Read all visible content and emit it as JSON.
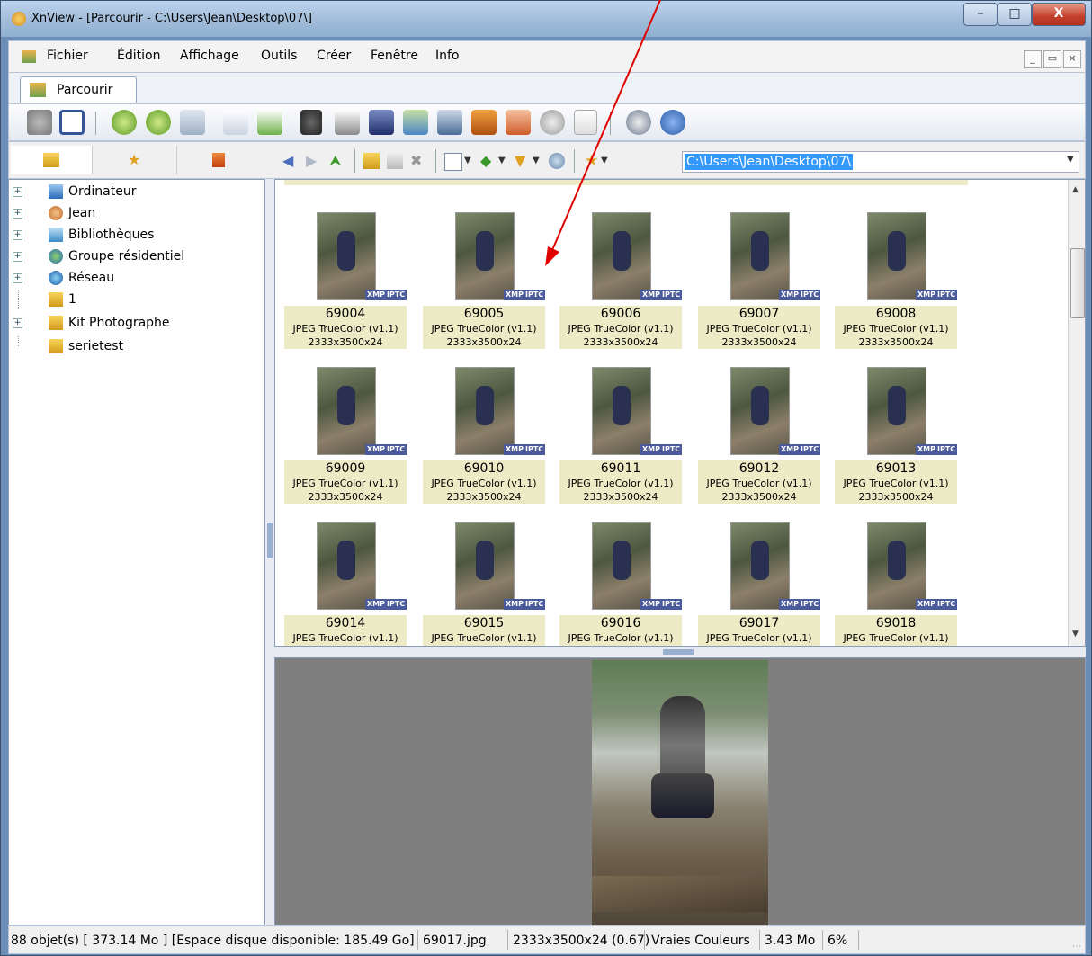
{
  "window": {
    "title": "XnView - [Parcourir - C:\\Users\\Jean\\Desktop\\07\\]",
    "min_label": "–",
    "max_label": "□",
    "close_label": "X"
  },
  "menubar": {
    "items": [
      "Fichier",
      "Édition",
      "Affichage",
      "Outils",
      "Créer",
      "Fenêtre",
      "Info"
    ],
    "mdi": [
      "_",
      "̅̅",
      "×"
    ]
  },
  "tabs": [
    {
      "label": "Parcourir"
    }
  ],
  "address": {
    "path": "C:\\Users\\Jean\\Desktop\\07\\"
  },
  "tree": [
    {
      "label": "Ordinateur",
      "expander": "+"
    },
    {
      "label": "Jean",
      "expander": "+"
    },
    {
      "label": "Bibliothèques",
      "expander": "+"
    },
    {
      "label": "Groupe résidentiel",
      "expander": "+"
    },
    {
      "label": "Réseau",
      "expander": "+"
    },
    {
      "label": "1",
      "expander": ""
    },
    {
      "label": "Kit Photographe",
      "expander": "+"
    },
    {
      "label": "serietest",
      "expander": ""
    }
  ],
  "thumbnails": {
    "format": "JPEG TrueColor (v1.1)",
    "size": "2333x3500x24",
    "badges": [
      "XMP",
      "IPTC"
    ],
    "items": [
      "69004",
      "69005",
      "69006",
      "69007",
      "69008",
      "69009",
      "69010",
      "69011",
      "69012",
      "69013",
      "69014",
      "69015",
      "69016",
      "69017",
      "69018"
    ]
  },
  "statusbar": {
    "count": "88 objet(s) [ 373.14 Mo ] [Espace disque disponible: 185.49 Go]",
    "file": "69017.jpg",
    "dims": "2333x3500x24 (0.67)",
    "color": "Vraies Couleurs",
    "filesize": "3.43 Mo",
    "zoom": "6%"
  },
  "colors": {
    "label_bg": "#ecebc6",
    "path_selection": "#3399ff",
    "annotation_arrow": "#e00000"
  }
}
